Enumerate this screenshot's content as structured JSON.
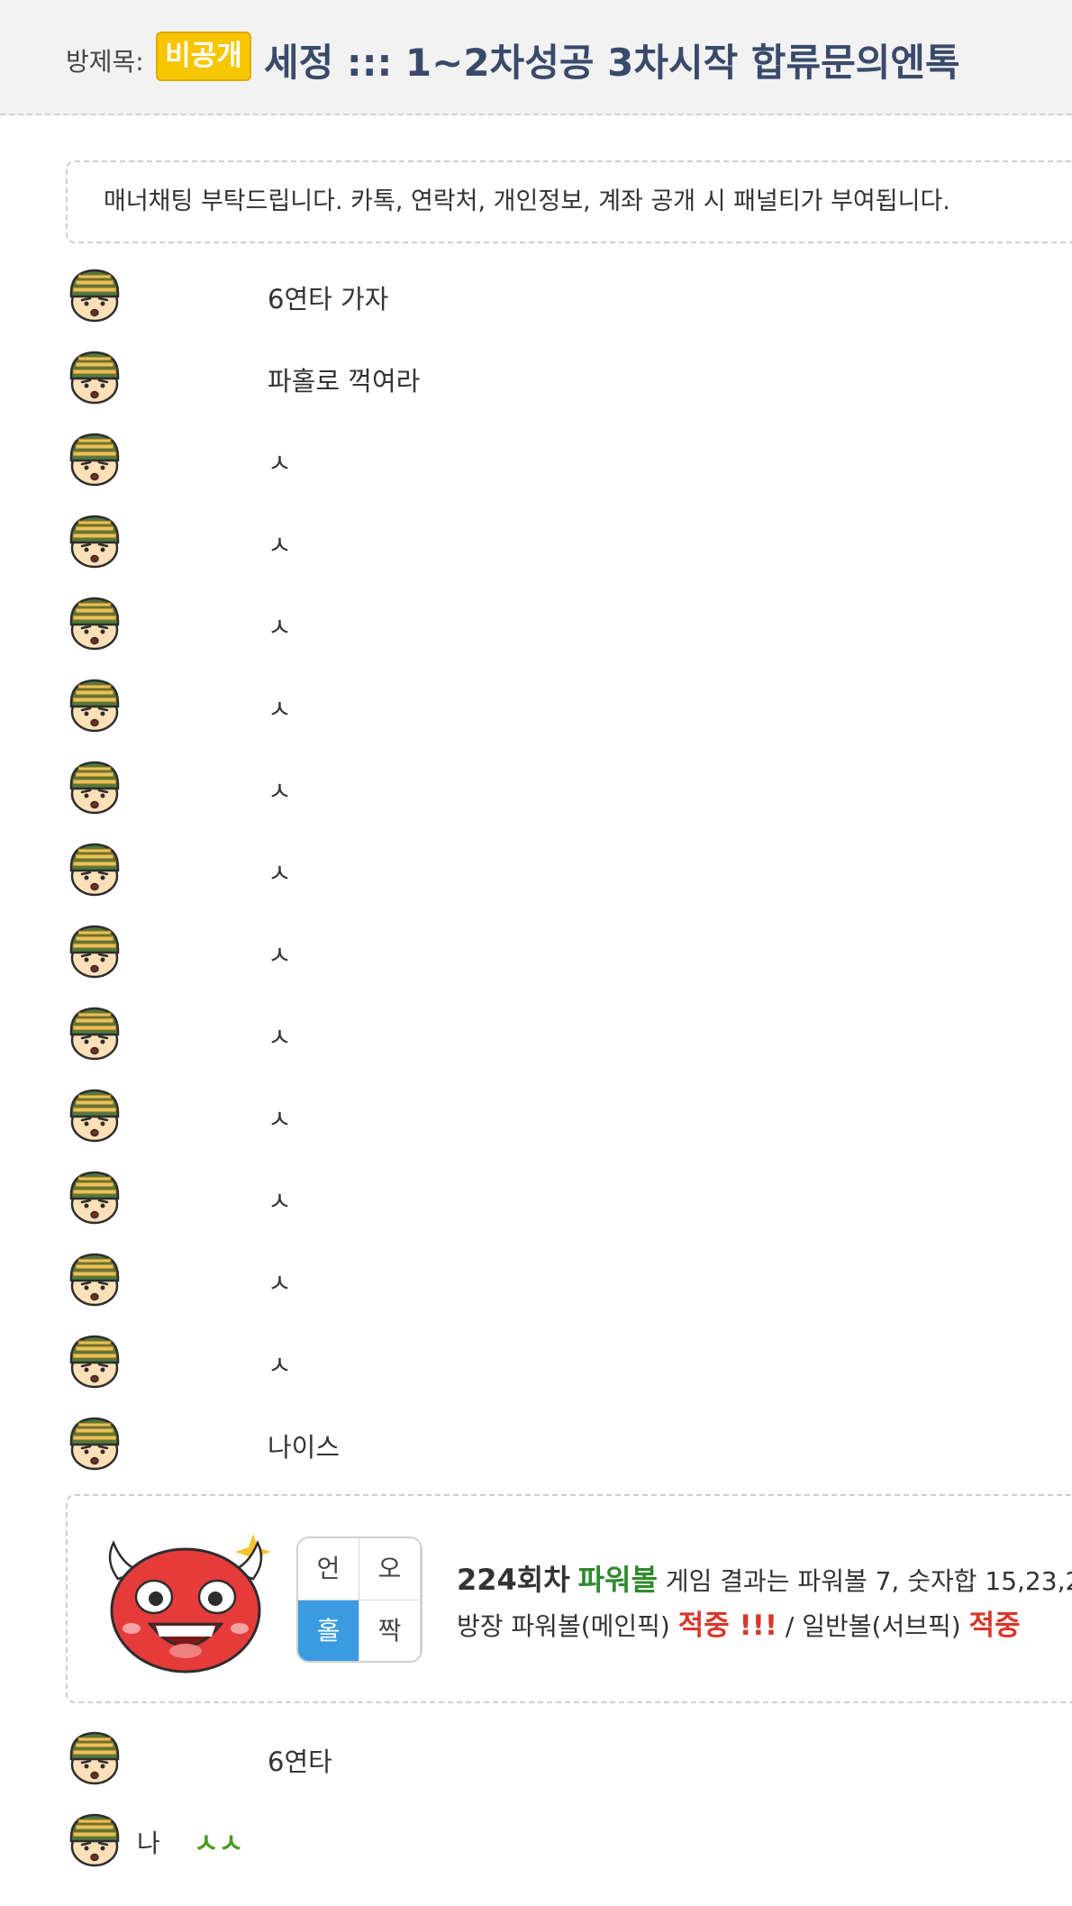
{
  "header": {
    "label": "방제목:",
    "badge": "비공개",
    "title": "세정 ::: 1~2차성공 3차시작 합류문의엔톡"
  },
  "notice": "매너채팅 부탁드립니다. 카톡, 연락처, 개인정보, 계좌 공개 시 패널티가 부여됩니다.",
  "messages": [
    {
      "text": "6연타 가자"
    },
    {
      "text": "파홀로 꺽여라"
    },
    {
      "text": "ㅅ"
    },
    {
      "text": "ㅅ"
    },
    {
      "text": "ㅅ"
    },
    {
      "text": "ㅅ"
    },
    {
      "text": "ㅅ"
    },
    {
      "text": "ㅅ"
    },
    {
      "text": "ㅅ"
    },
    {
      "text": "ㅅ"
    },
    {
      "text": "ㅅ"
    },
    {
      "text": "ㅅ"
    },
    {
      "text": "ㅅ"
    },
    {
      "text": "ㅅ"
    },
    {
      "text": "나이스"
    }
  ],
  "result": {
    "grid": {
      "top_left": "언",
      "top_right": "오",
      "bottom_left": "홀",
      "bottom_right": "짝",
      "selected": "홀"
    },
    "round": "224회차",
    "game": "파워볼",
    "line1_rest": "게임 결과는 파워볼 7, 숫자합 15,23,2",
    "line2_main": "방장 파워볼(메인픽)",
    "hit1": "적중 !!!",
    "sep": "/",
    "line2_sub": "일반볼(서브픽)",
    "hit2": "적중"
  },
  "after_messages": [
    {
      "text": "6연타"
    }
  ],
  "last_message": {
    "nick": "나",
    "nick_mark": "ㅅㅅ"
  },
  "colors": {
    "badge_bg": "#f7c600",
    "title": "#3a4a6b",
    "game_green": "#2e8b2e",
    "hit_red": "#d9362b",
    "selected_cell": "#3a9be0",
    "nick_mark_green": "#4a9a1e"
  }
}
